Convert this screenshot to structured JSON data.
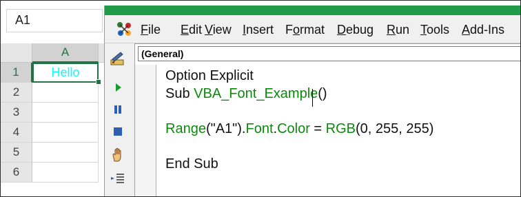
{
  "excel": {
    "name_box": "A1",
    "column_header": "A",
    "rows": [
      "1",
      "2",
      "3",
      "4",
      "5",
      "6"
    ],
    "cell_a1": "Hello",
    "cell_a1_color": "#00ffff"
  },
  "vbe": {
    "menu": [
      {
        "label": "File",
        "ul": "F",
        "rest": "ile"
      },
      {
        "label": "Edit",
        "ul": "E",
        "rest": "dit"
      },
      {
        "label": "View",
        "ul": "V",
        "rest": "iew"
      },
      {
        "label": "Insert",
        "ul": "I",
        "rest": "nsert"
      },
      {
        "label": "Format",
        "pre": "F",
        "ul": "o",
        "rest": "rmat"
      },
      {
        "label": "Debug",
        "ul": "D",
        "rest": "ebug"
      },
      {
        "label": "Run",
        "ul": "R",
        "rest": "un"
      },
      {
        "label": "Tools",
        "ul": "T",
        "rest": "ools"
      },
      {
        "label": "Add-Ins",
        "ul": "A",
        "rest": "dd-Ins"
      }
    ],
    "object_combo": "(General)",
    "code": {
      "line1": "Option Explicit",
      "sub_kw": "Sub ",
      "sub_name": "VBA_Font_Example",
      "sub_parens": "()",
      "range": "Range",
      "range_arg": "(\"A1\").",
      "font": "Font",
      "dot": ".",
      "color": "Color",
      "eq": " = ",
      "rgb": "RGB",
      "rgb_args": "(0, 255, 255)",
      "end_sub": "End Sub"
    },
    "colors": {
      "identifier": "#0a8a0a",
      "title_bar": "#1f9b4a"
    },
    "toolbar_icons": [
      "design-mode-icon",
      "run-icon",
      "break-icon",
      "reset-icon",
      "hand-icon",
      "indent-icon"
    ]
  }
}
